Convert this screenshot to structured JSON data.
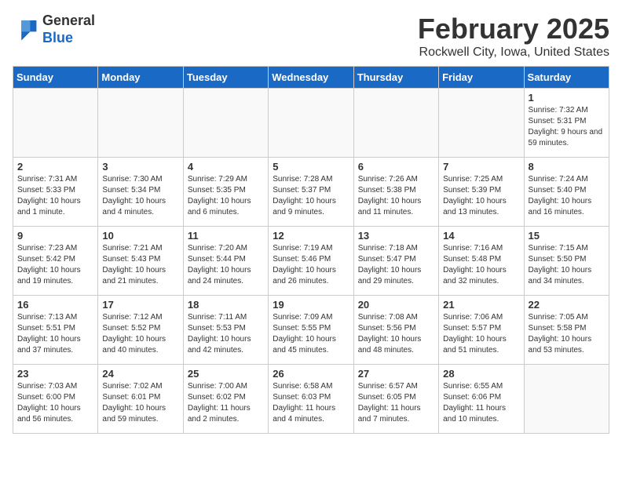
{
  "logo": {
    "general": "General",
    "blue": "Blue"
  },
  "title": "February 2025",
  "location": "Rockwell City, Iowa, United States",
  "days_of_week": [
    "Sunday",
    "Monday",
    "Tuesday",
    "Wednesday",
    "Thursday",
    "Friday",
    "Saturday"
  ],
  "weeks": [
    [
      {
        "day": "",
        "info": ""
      },
      {
        "day": "",
        "info": ""
      },
      {
        "day": "",
        "info": ""
      },
      {
        "day": "",
        "info": ""
      },
      {
        "day": "",
        "info": ""
      },
      {
        "day": "",
        "info": ""
      },
      {
        "day": "1",
        "info": "Sunrise: 7:32 AM\nSunset: 5:31 PM\nDaylight: 9 hours and 59 minutes."
      }
    ],
    [
      {
        "day": "2",
        "info": "Sunrise: 7:31 AM\nSunset: 5:33 PM\nDaylight: 10 hours and 1 minute."
      },
      {
        "day": "3",
        "info": "Sunrise: 7:30 AM\nSunset: 5:34 PM\nDaylight: 10 hours and 4 minutes."
      },
      {
        "day": "4",
        "info": "Sunrise: 7:29 AM\nSunset: 5:35 PM\nDaylight: 10 hours and 6 minutes."
      },
      {
        "day": "5",
        "info": "Sunrise: 7:28 AM\nSunset: 5:37 PM\nDaylight: 10 hours and 9 minutes."
      },
      {
        "day": "6",
        "info": "Sunrise: 7:26 AM\nSunset: 5:38 PM\nDaylight: 10 hours and 11 minutes."
      },
      {
        "day": "7",
        "info": "Sunrise: 7:25 AM\nSunset: 5:39 PM\nDaylight: 10 hours and 13 minutes."
      },
      {
        "day": "8",
        "info": "Sunrise: 7:24 AM\nSunset: 5:40 PM\nDaylight: 10 hours and 16 minutes."
      }
    ],
    [
      {
        "day": "9",
        "info": "Sunrise: 7:23 AM\nSunset: 5:42 PM\nDaylight: 10 hours and 19 minutes."
      },
      {
        "day": "10",
        "info": "Sunrise: 7:21 AM\nSunset: 5:43 PM\nDaylight: 10 hours and 21 minutes."
      },
      {
        "day": "11",
        "info": "Sunrise: 7:20 AM\nSunset: 5:44 PM\nDaylight: 10 hours and 24 minutes."
      },
      {
        "day": "12",
        "info": "Sunrise: 7:19 AM\nSunset: 5:46 PM\nDaylight: 10 hours and 26 minutes."
      },
      {
        "day": "13",
        "info": "Sunrise: 7:18 AM\nSunset: 5:47 PM\nDaylight: 10 hours and 29 minutes."
      },
      {
        "day": "14",
        "info": "Sunrise: 7:16 AM\nSunset: 5:48 PM\nDaylight: 10 hours and 32 minutes."
      },
      {
        "day": "15",
        "info": "Sunrise: 7:15 AM\nSunset: 5:50 PM\nDaylight: 10 hours and 34 minutes."
      }
    ],
    [
      {
        "day": "16",
        "info": "Sunrise: 7:13 AM\nSunset: 5:51 PM\nDaylight: 10 hours and 37 minutes."
      },
      {
        "day": "17",
        "info": "Sunrise: 7:12 AM\nSunset: 5:52 PM\nDaylight: 10 hours and 40 minutes."
      },
      {
        "day": "18",
        "info": "Sunrise: 7:11 AM\nSunset: 5:53 PM\nDaylight: 10 hours and 42 minutes."
      },
      {
        "day": "19",
        "info": "Sunrise: 7:09 AM\nSunset: 5:55 PM\nDaylight: 10 hours and 45 minutes."
      },
      {
        "day": "20",
        "info": "Sunrise: 7:08 AM\nSunset: 5:56 PM\nDaylight: 10 hours and 48 minutes."
      },
      {
        "day": "21",
        "info": "Sunrise: 7:06 AM\nSunset: 5:57 PM\nDaylight: 10 hours and 51 minutes."
      },
      {
        "day": "22",
        "info": "Sunrise: 7:05 AM\nSunset: 5:58 PM\nDaylight: 10 hours and 53 minutes."
      }
    ],
    [
      {
        "day": "23",
        "info": "Sunrise: 7:03 AM\nSunset: 6:00 PM\nDaylight: 10 hours and 56 minutes."
      },
      {
        "day": "24",
        "info": "Sunrise: 7:02 AM\nSunset: 6:01 PM\nDaylight: 10 hours and 59 minutes."
      },
      {
        "day": "25",
        "info": "Sunrise: 7:00 AM\nSunset: 6:02 PM\nDaylight: 11 hours and 2 minutes."
      },
      {
        "day": "26",
        "info": "Sunrise: 6:58 AM\nSunset: 6:03 PM\nDaylight: 11 hours and 4 minutes."
      },
      {
        "day": "27",
        "info": "Sunrise: 6:57 AM\nSunset: 6:05 PM\nDaylight: 11 hours and 7 minutes."
      },
      {
        "day": "28",
        "info": "Sunrise: 6:55 AM\nSunset: 6:06 PM\nDaylight: 11 hours and 10 minutes."
      },
      {
        "day": "",
        "info": ""
      }
    ]
  ]
}
